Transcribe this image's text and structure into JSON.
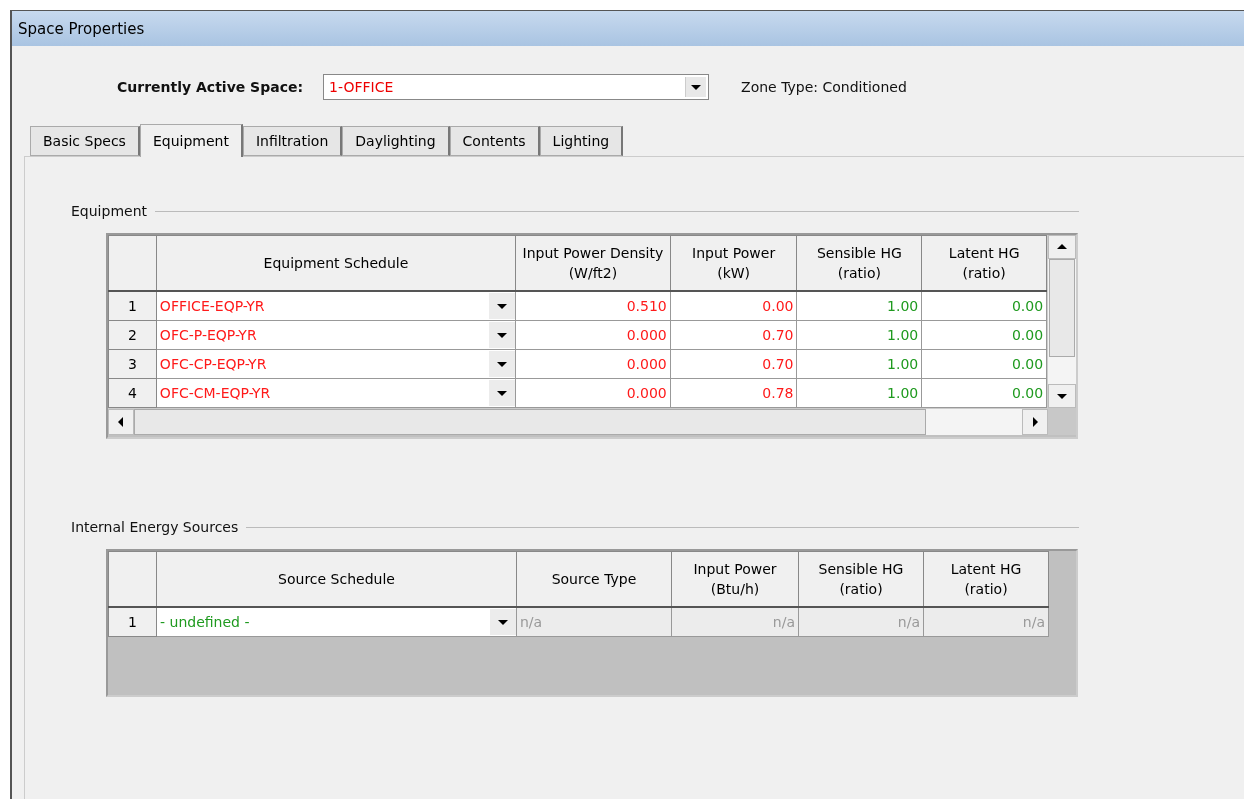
{
  "window": {
    "title": "Space Properties"
  },
  "active_space": {
    "label": "Currently Active Space:",
    "value": "1-OFFICE"
  },
  "zone_type": "Zone Type: Conditioned",
  "tabs": [
    {
      "label": "Basic Specs",
      "selected": false
    },
    {
      "label": "Equipment",
      "selected": true
    },
    {
      "label": "Infiltration",
      "selected": false
    },
    {
      "label": "Daylighting",
      "selected": false
    },
    {
      "label": "Contents",
      "selected": false
    },
    {
      "label": "Lighting",
      "selected": false
    }
  ],
  "equipment": {
    "title": "Equipment",
    "columns": [
      {
        "label": "Equipment Schedule",
        "kind": "schedule",
        "defaulted": false,
        "disabled": false
      },
      {
        "label": "Input Power Density (W/ft2)",
        "kind": "number",
        "defaulted": false,
        "disabled": false
      },
      {
        "label": "Input Power (kW)",
        "kind": "number",
        "defaulted": false,
        "disabled": false
      },
      {
        "label": "Sensible HG (ratio)",
        "kind": "number",
        "defaulted": true,
        "disabled": false
      },
      {
        "label": "Latent HG (ratio)",
        "kind": "number",
        "defaulted": true,
        "disabled": false
      }
    ],
    "rows": [
      {
        "number": "1",
        "cells": [
          "OFFICE-EQP-YR",
          "0.510",
          "0.00",
          "1.00",
          "0.00"
        ]
      },
      {
        "number": "2",
        "cells": [
          "OFC-P-EQP-YR",
          "0.000",
          "0.70",
          "1.00",
          "0.00"
        ]
      },
      {
        "number": "3",
        "cells": [
          "OFC-CP-EQP-YR",
          "0.000",
          "0.70",
          "1.00",
          "0.00"
        ]
      },
      {
        "number": "4",
        "cells": [
          "OFC-CM-EQP-YR",
          "0.000",
          "0.78",
          "1.00",
          "0.00"
        ]
      }
    ]
  },
  "internal_energy_sources": {
    "title": "Internal Energy Sources",
    "columns": [
      {
        "label": "Source Schedule",
        "kind": "schedule",
        "defaulted": true,
        "disabled": false
      },
      {
        "label": "Source Type",
        "kind": "text",
        "disabled": true
      },
      {
        "label": "Input Power (Btu/h)",
        "kind": "number",
        "disabled": true
      },
      {
        "label": "Sensible HG (ratio)",
        "kind": "number",
        "disabled": true
      },
      {
        "label": "Latent HG (ratio)",
        "kind": "number",
        "disabled": true
      }
    ],
    "rows": [
      {
        "number": "1",
        "cells": [
          "- undefined -",
          "n/a",
          "n/a",
          "n/a",
          "n/a"
        ]
      }
    ]
  }
}
